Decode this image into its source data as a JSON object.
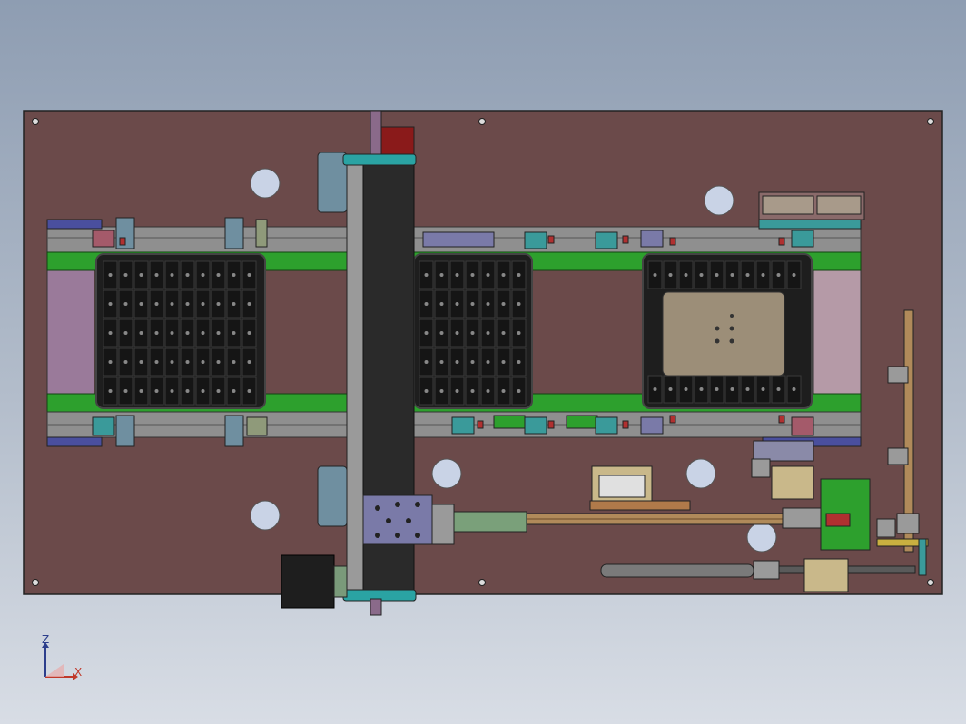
{
  "view": {
    "background_top": "#8e9db2",
    "background_bottom": "#d8dde5"
  },
  "model": {
    "base_plate_color": "#6b4a4a",
    "conveyor_belt_color": "#2da02d",
    "tray_color": "#1e1e1e",
    "gantry_color": "#2a2a2a"
  },
  "triad": {
    "x_label": "X",
    "z_label": "Z",
    "x_color": "#c0392b",
    "z_color": "#2c3e8c"
  }
}
